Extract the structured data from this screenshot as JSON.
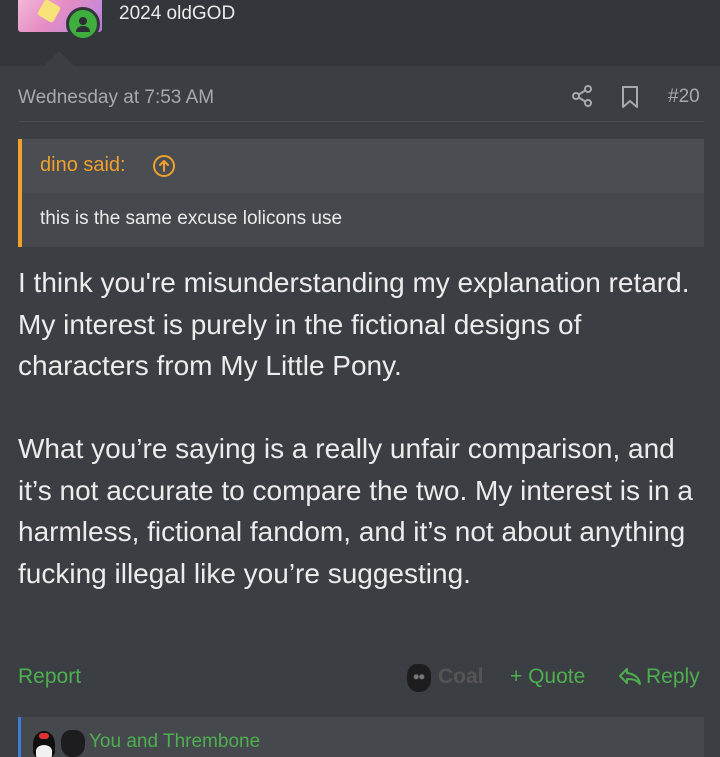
{
  "profile": {
    "username_line": "2024 oldGOD"
  },
  "post": {
    "timestamp": "Wednesday at 7:53 AM",
    "post_number": "#20",
    "quote": {
      "author": "dino said:",
      "text": "this is the same excuse lolicons use"
    },
    "body": [
      "I think you're misunderstanding my explanation retard. My interest is purely in the fictional designs of characters from My Little Pony.",
      "What you’re saying is a really unfair comparison, and it’s not accurate to compare the two. My interest is in a harmless, fictional fandom, and it’s not about anything fucking illegal like you’re suggesting."
    ]
  },
  "actions": {
    "report": "Report",
    "coal_name": "Coal",
    "quote": "+ Quote",
    "reply": "Reply"
  },
  "reactions": {
    "text": "You and Thrembone"
  },
  "colors": {
    "background": "#3b3e43",
    "quote_accent": "#f0a02b",
    "action_green": "#4fae4f",
    "reactions_border": "#3e7fd6",
    "online_badge": "#3fae3f"
  }
}
